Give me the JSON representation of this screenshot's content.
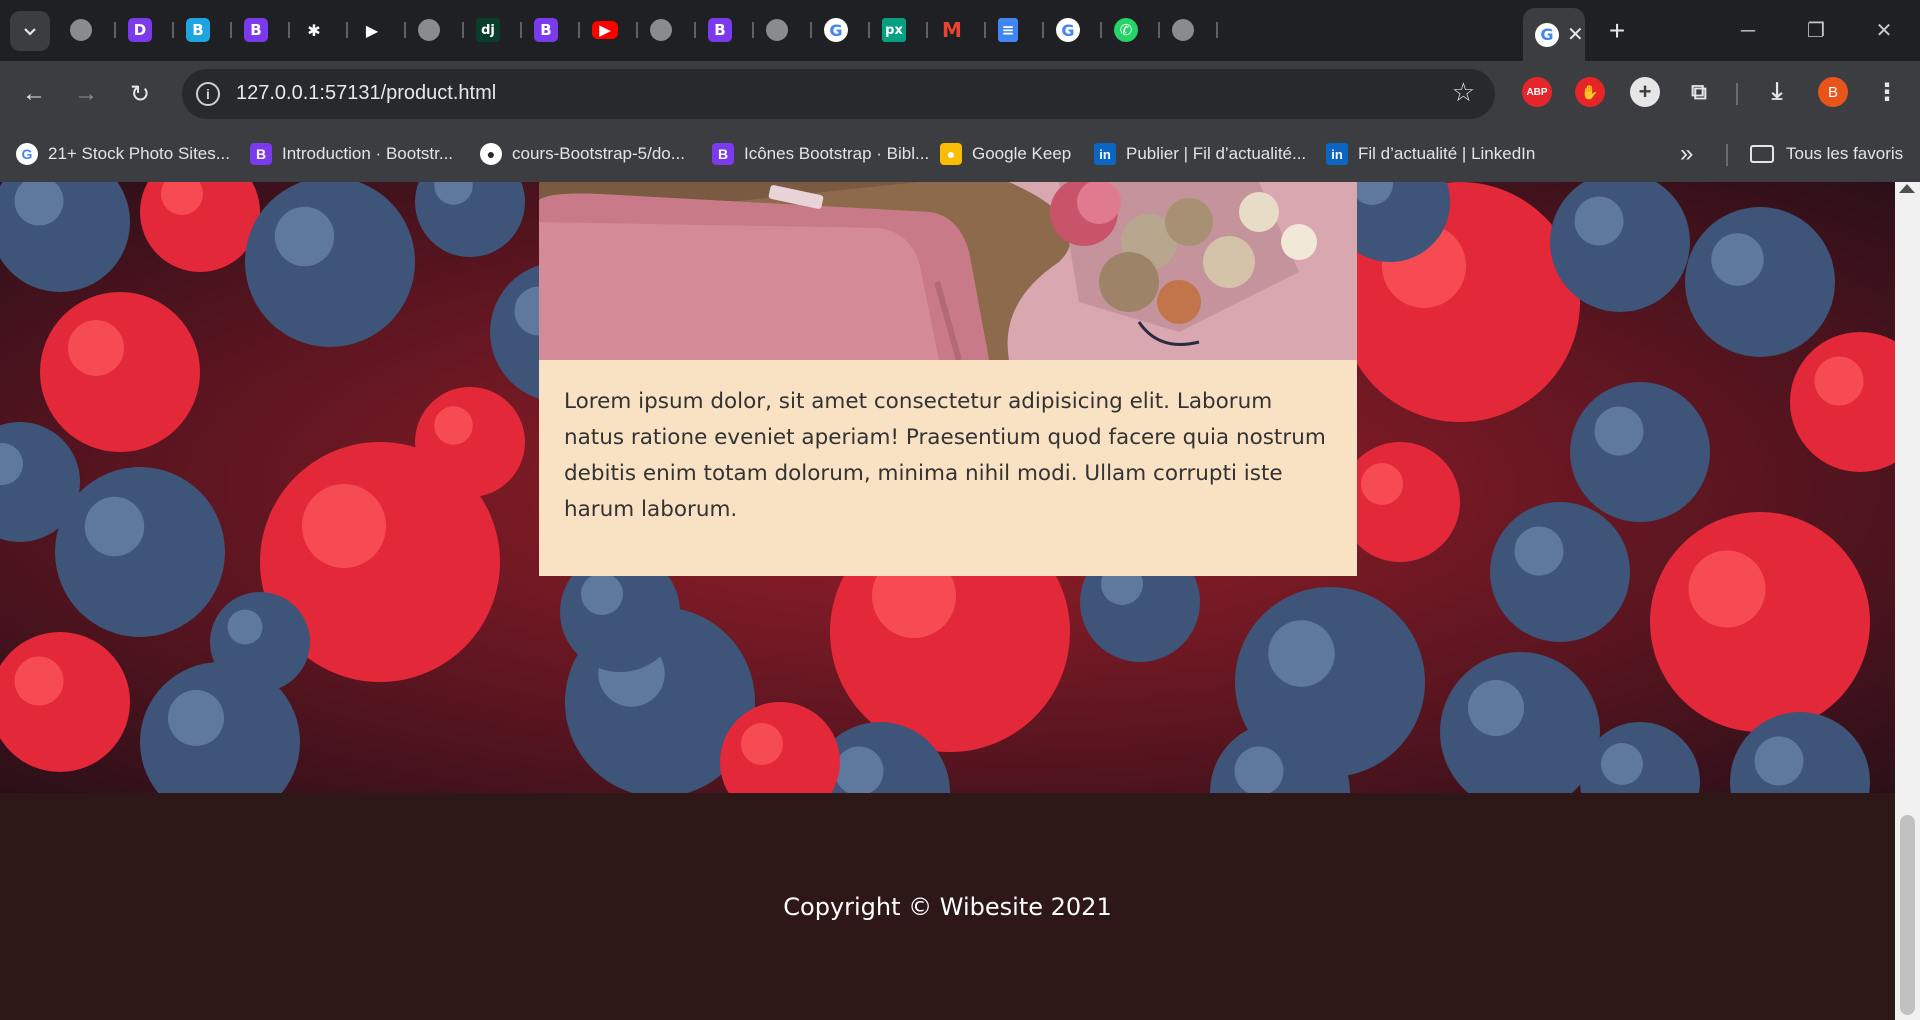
{
  "tabs": [
    {
      "icon": "globe-icon",
      "glyph": ""
    },
    {
      "icon": "bitly-icon",
      "glyph": "D"
    },
    {
      "icon": "bootstrap-blue-icon",
      "glyph": "B"
    },
    {
      "icon": "bootstrap-icon",
      "glyph": "B"
    },
    {
      "icon": "odoo-leaf-icon",
      "glyph": "✱"
    },
    {
      "icon": "play-icon",
      "glyph": "▶"
    },
    {
      "icon": "globe-icon",
      "glyph": ""
    },
    {
      "icon": "django-icon",
      "glyph": "dj"
    },
    {
      "icon": "bootstrap-icon",
      "glyph": "B"
    },
    {
      "icon": "youtube-icon",
      "glyph": "▶"
    },
    {
      "icon": "globe-icon",
      "glyph": ""
    },
    {
      "icon": "bootstrap-icon",
      "glyph": "B"
    },
    {
      "icon": "globe-icon",
      "glyph": ""
    },
    {
      "icon": "google-icon",
      "glyph": "G"
    },
    {
      "icon": "pixlr-icon",
      "glyph": "px"
    },
    {
      "icon": "gmail-icon",
      "glyph": "M"
    },
    {
      "icon": "google-docs-icon",
      "glyph": "≡"
    },
    {
      "icon": "google-icon",
      "glyph": "G"
    },
    {
      "icon": "whatsapp-icon",
      "glyph": "✆"
    },
    {
      "icon": "globe-icon",
      "glyph": ""
    }
  ],
  "active_tab": {
    "icon": "google-icon",
    "glyph": "G",
    "close": "✕"
  },
  "new_tab_label": "+",
  "window_controls": {
    "minimize": "─",
    "restore": "❐",
    "close": "✕"
  },
  "toolbar": {
    "back": "←",
    "forward": "→",
    "reload": "↻",
    "info": "i",
    "url": "127.0.0.1:57131/product.html",
    "star": "☆",
    "ext_abp": "ABP",
    "ext_hand": "✋",
    "ext_plus": "+",
    "ext_puzzle": "⧉",
    "download": "⤓",
    "avatar": "B",
    "menu": "⋮"
  },
  "bookmarks": [
    {
      "label": "21+ Stock Photo Sites...",
      "icon": "google-icon",
      "glyph": "G",
      "cls": "g"
    },
    {
      "label": "Introduction · Bootstr...",
      "icon": "bootstrap-icon",
      "glyph": "B",
      "cls": "bs"
    },
    {
      "label": "cours-Bootstrap-5/do...",
      "icon": "github-icon",
      "glyph": "●",
      "cls": "gh"
    },
    {
      "label": "Icônes Bootstrap · Bibl...",
      "icon": "bootstrap-icon",
      "glyph": "B",
      "cls": "bs"
    },
    {
      "label": "Google Keep",
      "icon": "google-keep-icon",
      "glyph": "●",
      "cls": "keep"
    },
    {
      "label": "Publier | Fil d’actualité...",
      "icon": "linkedin-icon",
      "glyph": "in",
      "cls": "li"
    },
    {
      "label": "Fil d’actualité | LinkedIn",
      "icon": "linkedin-icon",
      "glyph": "in",
      "cls": "li"
    }
  ],
  "bookmarks_more": "»",
  "bookmarks_folder": "Tous les favoris",
  "page": {
    "card_text": "Lorem ipsum dolor, sit amet consectetur adipisicing elit. Laborum natus ratione eveniet aperiam! Praesentium quod facere quia nostrum debitis enim totam dolorum, minima nihil modi. Ullam corrupti iste harum laborum.",
    "footer_text": "Copyright © Wibesite 2021"
  },
  "colors": {
    "card_bg": "#f9e1c4",
    "footer_bg": "#2e1717",
    "browser_chrome": "#3c3d40"
  }
}
